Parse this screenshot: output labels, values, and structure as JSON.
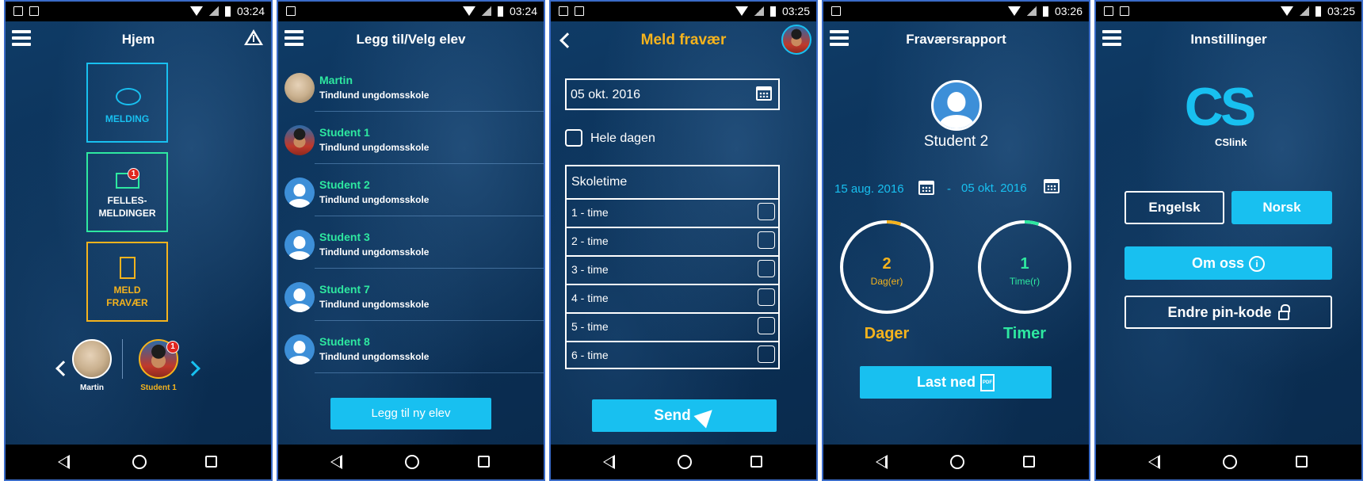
{
  "status_time": [
    "03:24",
    "03:24",
    "03:25",
    "03:26",
    "03:25"
  ],
  "colors": {
    "background": "#0b3157",
    "accent_cyan": "#18c0f0",
    "accent_green": "#2ee8a0",
    "accent_yellow": "#f5b31d",
    "badge_red": "#e0261f"
  },
  "icons": [
    "hamburger-icon",
    "warning-icon",
    "chat-bubble-icon",
    "envelope-icon",
    "document-icon",
    "chevron-left-icon",
    "chevron-right-icon",
    "calendar-icon",
    "send-icon",
    "pdf-icon",
    "info-icon",
    "lock-icon",
    "back-icon",
    "home-icon",
    "recent-apps-icon"
  ],
  "home": {
    "title": "Hjem",
    "tile_melding": "MELDING",
    "tile_felles_1": "FELLES-",
    "tile_felles_2": "MELDINGER",
    "tile_felles_badge": "1",
    "tile_fravaer_1": "MELD",
    "tile_fravaer_2": "FRAVÆR",
    "student_a": "Martin",
    "student_b": "Student 1",
    "student_b_badge": "1"
  },
  "select_student": {
    "title": "Legg til/Velg elev",
    "students": [
      {
        "name": "Martin",
        "school": "Tindlund ungdomsskole"
      },
      {
        "name": "Student 1",
        "school": "Tindlund ungdomsskole"
      },
      {
        "name": "Student 2",
        "school": "Tindlund ungdomsskole"
      },
      {
        "name": "Student 3",
        "school": "Tindlund ungdomsskole"
      },
      {
        "name": "Student 7",
        "school": "Tindlund ungdomsskole"
      },
      {
        "name": "Student 8",
        "school": "Tindlund ungdomsskole"
      }
    ],
    "add_button": "Legg til ny elev"
  },
  "report_absence": {
    "title": "Meld fravær",
    "date": "05 okt. 2016",
    "whole_day_label": "Hele dagen",
    "lessons_header": "Skoletime",
    "lessons": [
      "1 -   time",
      "2 -   time",
      "3 -   time",
      "4 -   time",
      "5 -   time",
      "6 -   time"
    ],
    "send_button": "Send"
  },
  "absence_report": {
    "title": "Fraværsrapport",
    "student": "Student 2",
    "date_from": "15 aug. 2016",
    "date_separator": "-",
    "date_to": "05 okt. 2016",
    "days_value": "2",
    "days_unit": "Dag(er)",
    "days_label": "Dager",
    "days_progress": 0.05,
    "hours_value": "1",
    "hours_unit": "Time(r)",
    "hours_label": "Timer",
    "hours_progress": 0.05,
    "download_button": "Last ned",
    "pdf_text": "PDF"
  },
  "settings": {
    "title": "Innstillinger",
    "logo_text": "CS",
    "logo_sub": "CSlink",
    "lang_english": "Engelsk",
    "lang_norwegian": "Norsk",
    "selected_language": "Norsk",
    "about_button": "Om oss",
    "info_glyph": "i",
    "change_pin_button": "Endre pin-kode"
  }
}
